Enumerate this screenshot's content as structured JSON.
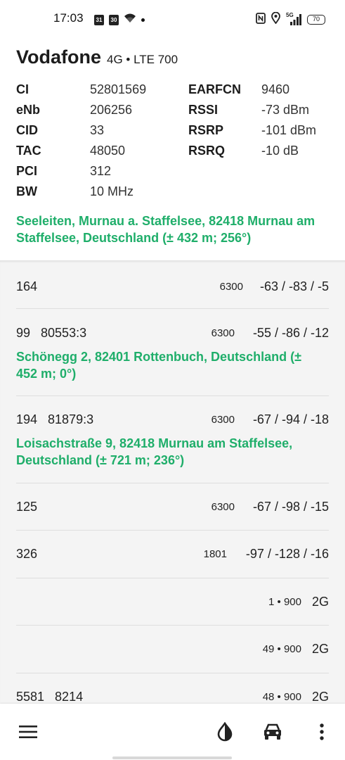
{
  "status_bar": {
    "time": "17:03",
    "calendar_day": "31",
    "calendar_day2": "30",
    "battery": "70",
    "network_label": "5G",
    "icons_left": [
      "calendar-icon",
      "calendar-icon",
      "wifi-icon",
      "notification-dot-icon"
    ],
    "icons_right": [
      "nfc-icon",
      "location-icon",
      "signal-5g-icon",
      "battery-icon"
    ]
  },
  "serving_cell": {
    "operator": "Vodafone",
    "technology": "4G • LTE 700",
    "left_fields": [
      {
        "label": "CI",
        "value": "52801569"
      },
      {
        "label": "eNb",
        "value": "206256"
      },
      {
        "label": "CID",
        "value": "33"
      },
      {
        "label": "TAC",
        "value": "48050"
      },
      {
        "label": "PCI",
        "value": "312"
      },
      {
        "label": "BW",
        "value": "10 MHz"
      }
    ],
    "right_fields": [
      {
        "label": "EARFCN",
        "value": "9460"
      },
      {
        "label": "RSSI",
        "value": "-73 dBm"
      },
      {
        "label": "RSRP",
        "value": "-101 dBm"
      },
      {
        "label": "RSRQ",
        "value": "-10 dB"
      }
    ],
    "location": "Seeleiten, Murnau a. Staffelsee, 82418 Murnau am Staffelsee, Deutschland (± 432 m; 256°)"
  },
  "neighbors": [
    {
      "left": "164",
      "earfcn": "6300",
      "signal": "-63 / -83 / -5",
      "location": ""
    },
    {
      "left": "99   80553:3",
      "earfcn": "6300",
      "signal": "-55 / -86 / -12",
      "location": "Schönegg 2, 82401 Rottenbuch, Deutschland (± 452 m; 0°)"
    },
    {
      "left": "194   81879:3",
      "earfcn": "6300",
      "signal": "-67 / -94 / -18",
      "location": "Loisachstraße 9, 82418 Murnau am Staffelsee, Deutschland (± 721 m; 236°)"
    },
    {
      "left": "125",
      "earfcn": "6300",
      "signal": "-67 / -98 / -15",
      "location": ""
    },
    {
      "left": "326",
      "earfcn": "1801",
      "signal": "-97 / -128 / -16",
      "location": ""
    },
    {
      "left": "",
      "earfcn": "1 • 900",
      "signal": "2G",
      "location": ""
    },
    {
      "left": "",
      "earfcn": "49 • 900",
      "signal": "2G",
      "location": ""
    },
    {
      "left": "5581   8214",
      "earfcn": "48 • 900",
      "signal": "2G",
      "location": ""
    }
  ],
  "bottom_bar": {
    "icons": [
      "menu-icon",
      "theme-contrast-icon",
      "car-icon",
      "more-vert-icon"
    ]
  },
  "colors": {
    "accent_green": "#1fae6a",
    "list_background": "#f4f4f4"
  }
}
